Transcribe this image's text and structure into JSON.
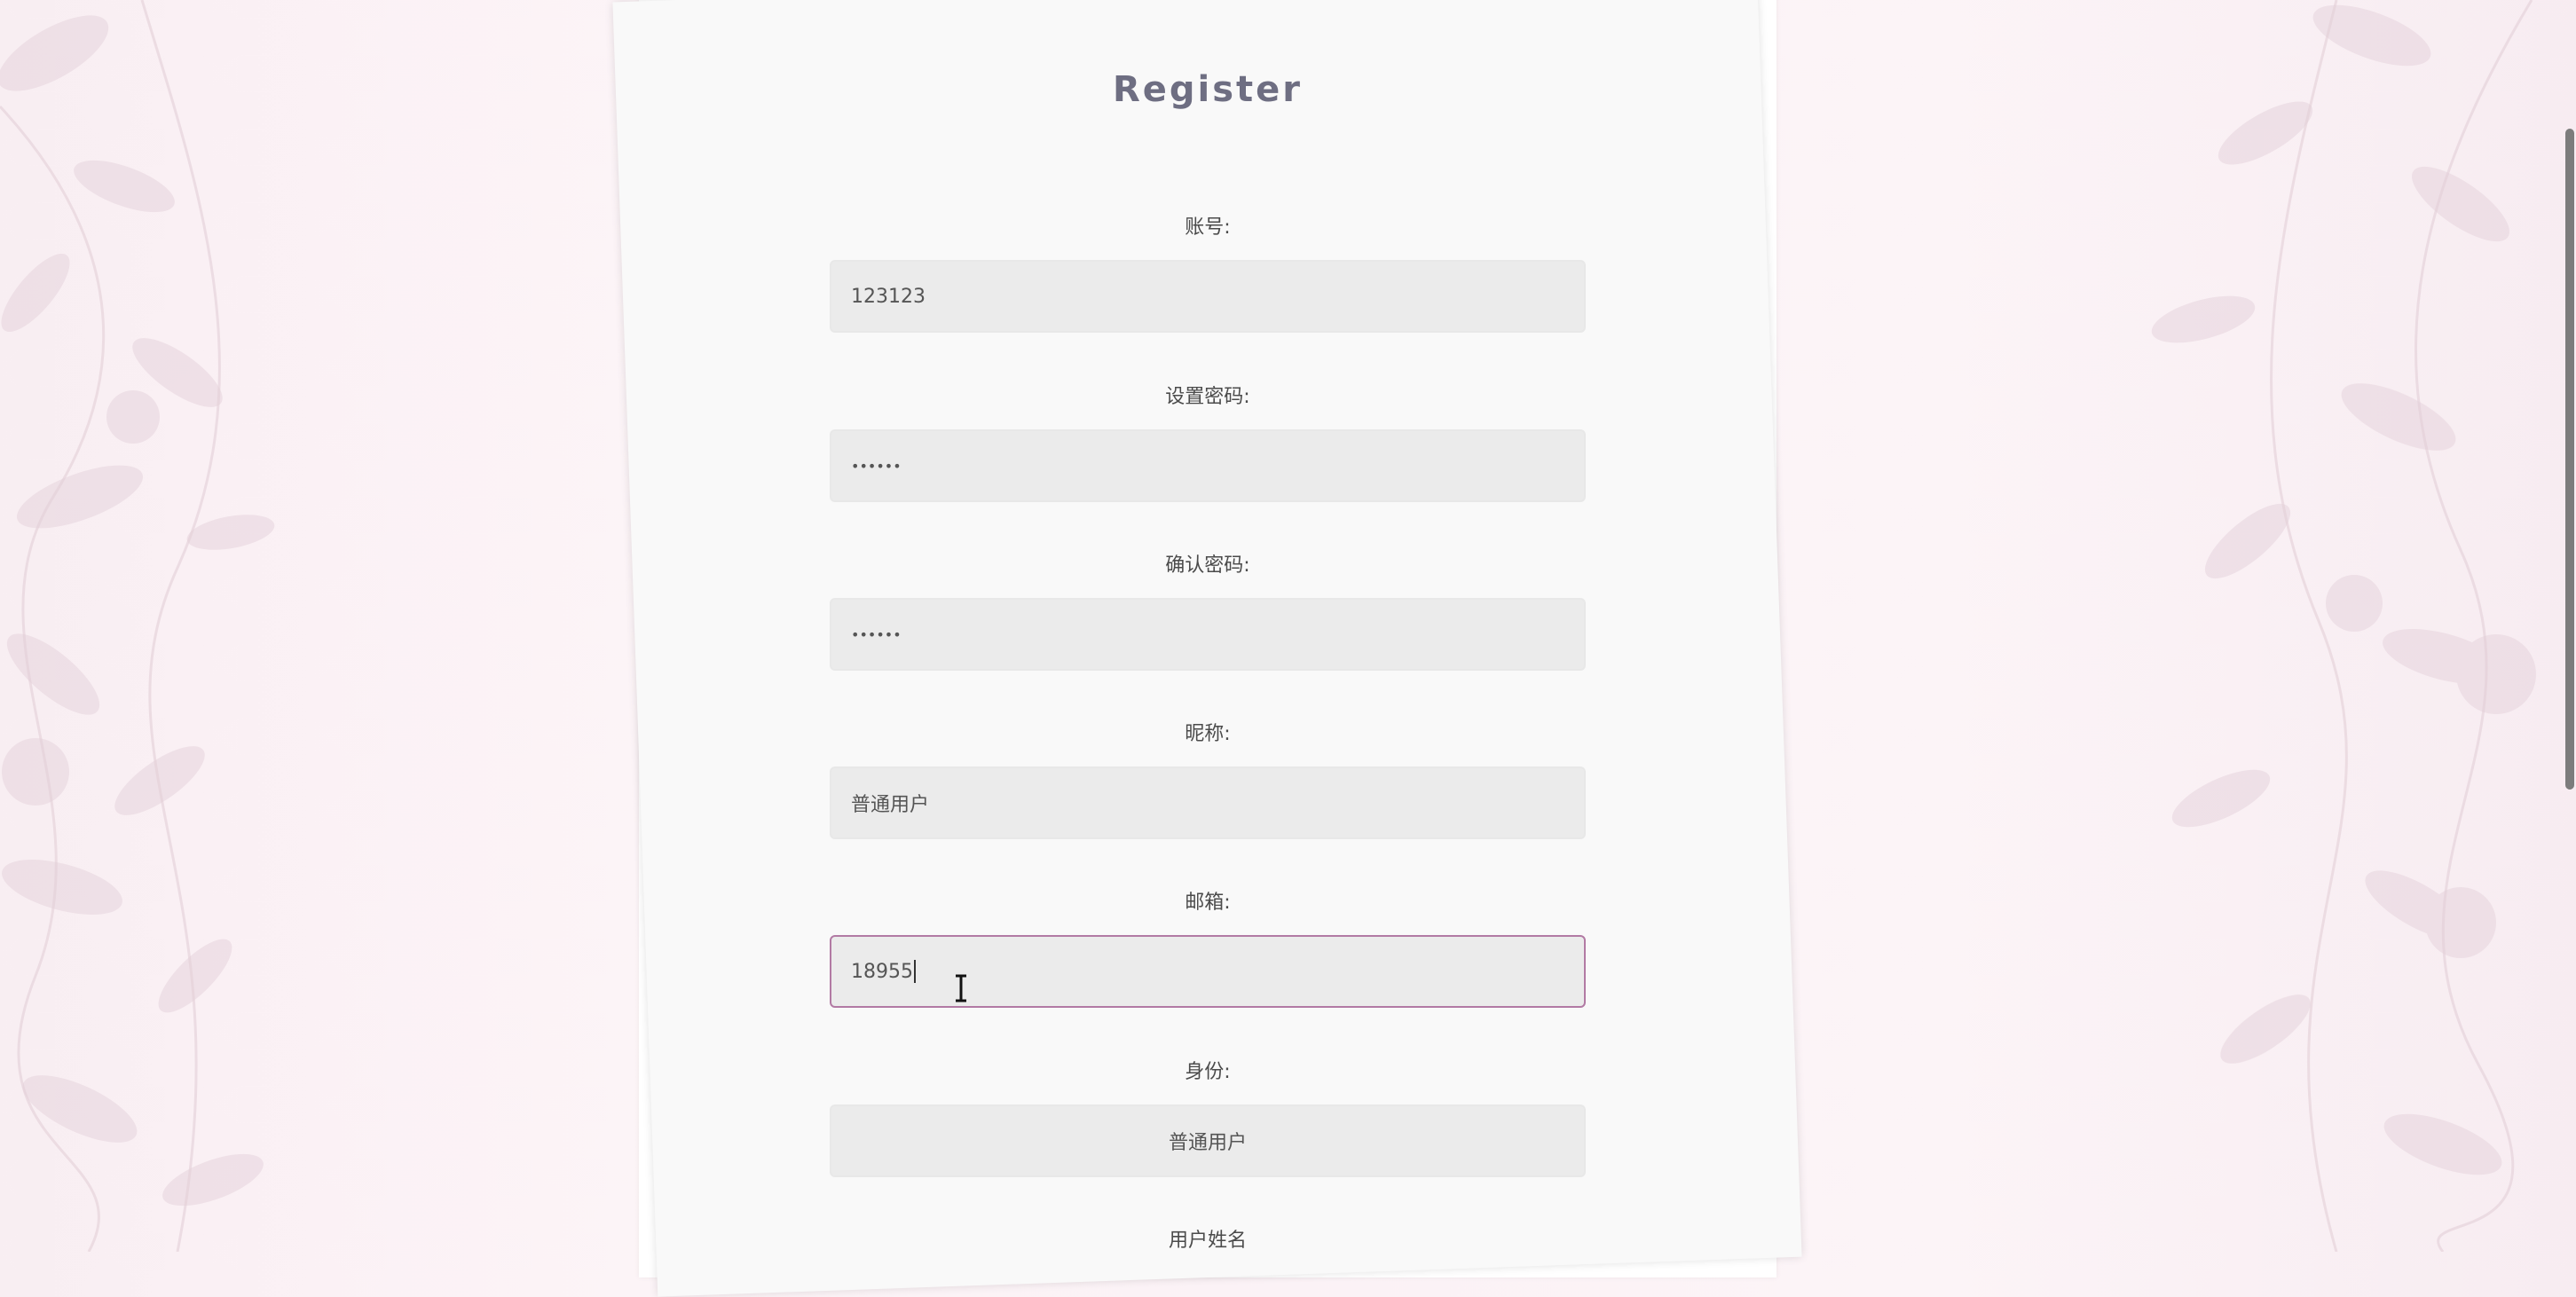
{
  "title": "Register",
  "fields": [
    {
      "label": "账号:",
      "value": "123123"
    },
    {
      "label": "设置密码:",
      "value": "••••••"
    },
    {
      "label": "确认密码:",
      "value": "••••••"
    },
    {
      "label": "昵称:",
      "value": "普通用户"
    },
    {
      "label": "邮箱:",
      "value": "18955"
    },
    {
      "label": "身份:",
      "value": "普通用户"
    },
    {
      "label": "用户姓名"
    }
  ],
  "colors": {
    "title": "#6e6e82",
    "field_bg": "#ebebeb",
    "focus_border": "#b27aa4",
    "card_bg": "#f9f9f9"
  }
}
